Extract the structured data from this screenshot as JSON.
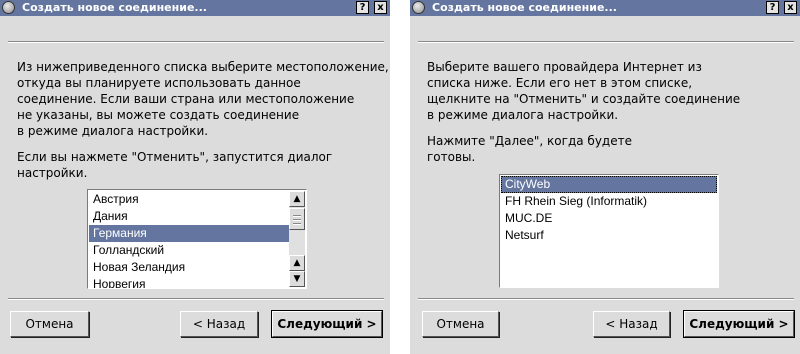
{
  "left_dialog": {
    "title": "Создать новое соединение...",
    "help_button": "?",
    "close_button": "x",
    "intro": "Из нижеприведенного списка выберите местоположение,\nоткуда вы планируете использовать данное\nсоединение. Если ваши страна или местоположение\nне указаны, вы можете создать соединение\nв режиме диалога настройки.",
    "cancel_note": "Если вы нажмете \"Отменить\", запустится диалог\nнастройки.",
    "countries": [
      "Австрия",
      "Дания",
      "Германия",
      "Голландский",
      "Новая Зеландия",
      "Норвегия"
    ],
    "selected_country": "Германия",
    "buttons": {
      "cancel": "Отмена",
      "back": "< Назад",
      "next": "Следующий >"
    }
  },
  "right_dialog": {
    "title": "Создать новое соединение...",
    "help_button": "?",
    "close_button": "x",
    "intro": "Выберите вашего провайдера Интернет из\nсписка ниже. Если его нет в этом списке,\nщелкните на \"Отменить\" и создайте соединение\nв режиме диалога настройки.",
    "next_note": "Нажмите \"Далее\", когда будете\nготовы.",
    "providers": [
      "CityWeb",
      "FH Rhein Sieg (Informatik)",
      "MUC.DE",
      "Netsurf"
    ],
    "selected_provider": "CityWeb",
    "buttons": {
      "cancel": "Отмена",
      "back": "< Назад",
      "next": "Следующий >"
    }
  },
  "colors": {
    "titlebar": "#6476a0",
    "dialog_bg": "#dcdcdc",
    "selection": "#6476a0",
    "list_bg": "#ffffff"
  }
}
